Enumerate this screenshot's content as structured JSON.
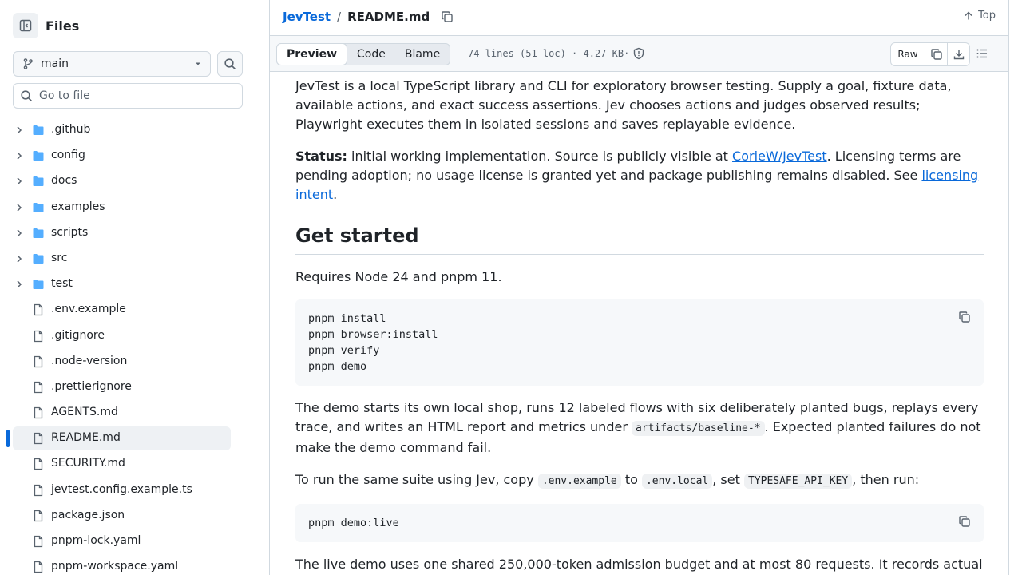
{
  "sidebar": {
    "title": "Files",
    "branch": "main",
    "search_placeholder": "Go to file",
    "items": [
      {
        "name": ".github",
        "type": "folder"
      },
      {
        "name": "config",
        "type": "folder"
      },
      {
        "name": "docs",
        "type": "folder"
      },
      {
        "name": "examples",
        "type": "folder"
      },
      {
        "name": "scripts",
        "type": "folder"
      },
      {
        "name": "src",
        "type": "folder"
      },
      {
        "name": "test",
        "type": "folder"
      },
      {
        "name": ".env.example",
        "type": "file"
      },
      {
        "name": ".gitignore",
        "type": "file"
      },
      {
        "name": ".node-version",
        "type": "file"
      },
      {
        "name": ".prettierignore",
        "type": "file"
      },
      {
        "name": "AGENTS.md",
        "type": "file"
      },
      {
        "name": "README.md",
        "type": "file",
        "active": true
      },
      {
        "name": "SECURITY.md",
        "type": "file"
      },
      {
        "name": "jevtest.config.example.ts",
        "type": "file"
      },
      {
        "name": "package.json",
        "type": "file"
      },
      {
        "name": "pnpm-lock.yaml",
        "type": "file"
      },
      {
        "name": "pnpm-workspace.yaml",
        "type": "file"
      }
    ]
  },
  "header": {
    "repo": "JevTest",
    "separator": "/",
    "file": "README.md",
    "top_label": "Top"
  },
  "toolbar": {
    "tabs": [
      "Preview",
      "Code",
      "Blame"
    ],
    "active_tab": "Preview",
    "meta": "74 lines (51 loc) · 4.27 KB·",
    "raw_label": "Raw"
  },
  "readme": {
    "intro": "JevTest is a local TypeScript library and CLI for exploratory browser testing. Supply a goal, fixture data, available actions, and exact success assertions. Jev chooses actions and judges observed results; Playwright executes them in isolated sessions and saves replayable evidence.",
    "status_label": "Status:",
    "status_text_1": " initial working implementation. Source is publicly visible at ",
    "status_link": "CorieW/JevTest",
    "status_text_2": ". Licensing terms are pending adoption; no usage license is granted yet and package publishing remains disabled. See ",
    "status_link_2": "licensing intent",
    "status_text_3": ".",
    "heading": "Get started",
    "requires": "Requires Node 24 and pnpm 11.",
    "code_block_1": "pnpm install\npnpm browser:install\npnpm verify\npnpm demo",
    "demo_text_1": "The demo starts its own local shop, runs 12 labeled flows with six deliberately planted bugs, replays every trace, and writes an HTML report and metrics under ",
    "demo_code": "artifacts/baseline-*",
    "demo_text_2": ". Expected planted failures do not make the demo command fail.",
    "run_text_1": "To run the same suite using Jev, copy ",
    "run_code_1": ".env.example",
    "run_text_2": " to ",
    "run_code_2": ".env.local",
    "run_text_3": ", set ",
    "run_code_3": "TYPESAFE_API_KEY",
    "run_text_4": ", then run:",
    "code_block_2": "pnpm demo:live",
    "live_text": "The live demo uses one shared 250,000-token admission budget and at most 80 requests. It records actual"
  }
}
